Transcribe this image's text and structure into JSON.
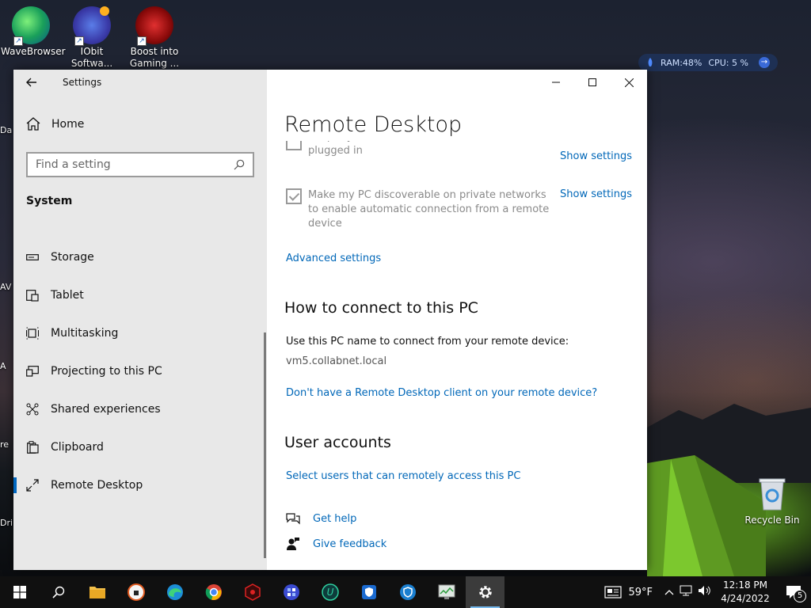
{
  "desktop": {
    "icons": [
      {
        "label_line1": "WaveBrowser",
        "label_line2": ""
      },
      {
        "label_line1": "IObit",
        "label_line2": "Softwa..."
      },
      {
        "label_line1": "Boost into",
        "label_line2": "Gaming ..."
      }
    ],
    "partial_labels": [
      "Da",
      "AV",
      "A",
      "re",
      "Dri"
    ],
    "recycle_bin": "Recycle Bin",
    "widget": {
      "ram": "RAM:48%",
      "cpu": "CPU: 5 %"
    }
  },
  "window": {
    "app_title": "Settings",
    "sidebar": {
      "home": "Home",
      "search_placeholder": "Find a setting",
      "section": "System",
      "items": [
        {
          "label": "Storage",
          "icon": "storage-icon"
        },
        {
          "label": "Tablet",
          "icon": "tablet-icon"
        },
        {
          "label": "Multitasking",
          "icon": "multitasking-icon"
        },
        {
          "label": "Projecting to this PC",
          "icon": "projecting-icon"
        },
        {
          "label": "Shared experiences",
          "icon": "shared-experiences-icon"
        },
        {
          "label": "Clipboard",
          "icon": "clipboard-icon"
        },
        {
          "label": "Remote Desktop",
          "icon": "remote-desktop-icon",
          "active": true
        }
      ]
    },
    "main": {
      "title": "Remote Desktop",
      "settings": [
        {
          "text": "Keep my PC awake for connections when it is plugged in",
          "checked": false,
          "link": "Show settings"
        },
        {
          "text": "Make my PC discoverable on private networks to enable automatic connection from a remote device",
          "checked": true,
          "link": "Show settings"
        }
      ],
      "advanced_link": "Advanced settings",
      "connect_heading": "How to connect to this PC",
      "connect_text": "Use this PC name to connect from your remote device:",
      "pc_name": "vm5.collabnet.local",
      "client_link": "Don't have a Remote Desktop client on your remote device?",
      "accounts_heading": "User accounts",
      "accounts_link": "Select users that can remotely access this PC",
      "get_help": "Get help",
      "give_feedback": "Give feedback"
    }
  },
  "taskbar": {
    "weather": "59°F",
    "time": "12:18 PM",
    "date": "4/24/2022",
    "notification_count": "5"
  }
}
